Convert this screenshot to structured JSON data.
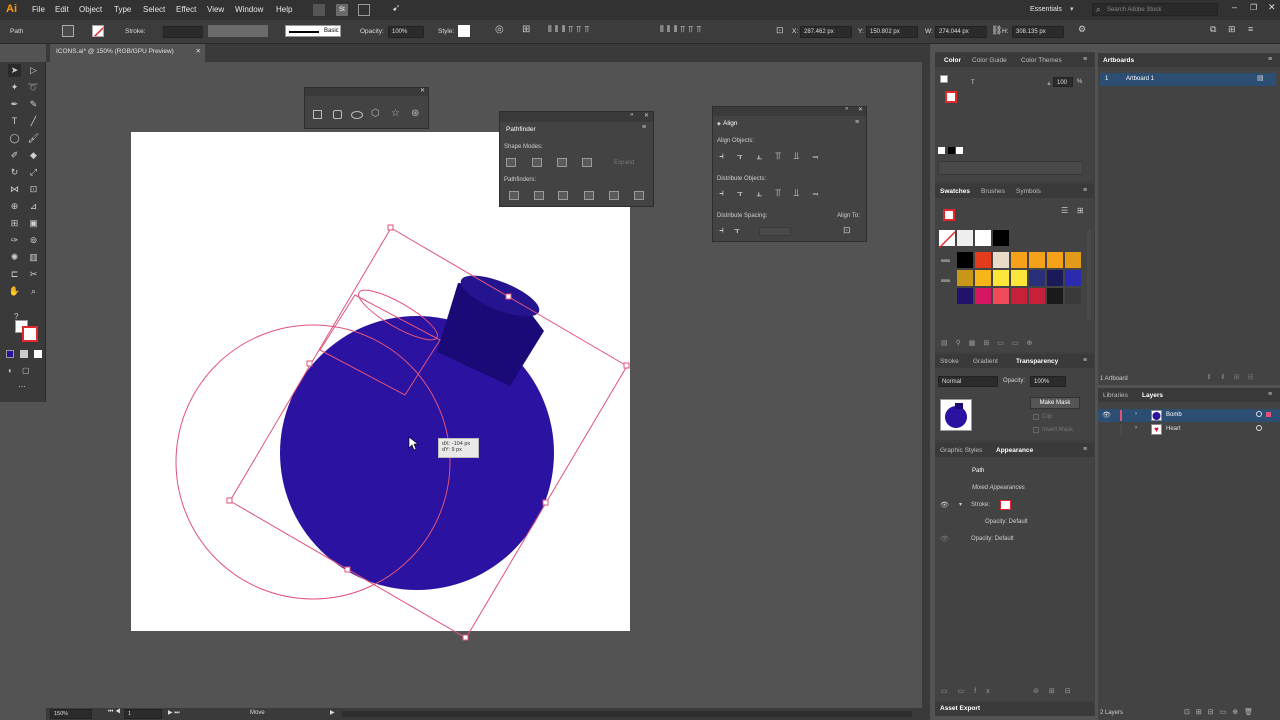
{
  "menubar": {
    "logo": "Ai",
    "menus": [
      "File",
      "Edit",
      "Object",
      "Type",
      "Select",
      "Effect",
      "View",
      "Window",
      "Help"
    ],
    "workspace": "Essentials",
    "search_placeholder": "Search Adobe Stock"
  },
  "controlbar": {
    "selection_label": "Path",
    "stroke_label": "Stroke:",
    "brush_label": "Basic",
    "opacity_label": "Opacity:",
    "opacity_value": "100%",
    "style_label": "Style:",
    "x_label": "X:",
    "x_value": "287.462 px",
    "y_label": "Y:",
    "y_value": "150.802 px",
    "w_label": "W:",
    "w_value": "274.044 px",
    "h_label": "H:",
    "h_value": "308.135 px"
  },
  "document": {
    "tab_title": "ICONS.ai* @ 150% (RGB/GPU Preview)",
    "tooltip_dx": "dX: -104 px",
    "tooltip_dy": "dY: 9 px"
  },
  "status": {
    "zoom": "150%",
    "artboard_num": "1",
    "tool_name": "Move"
  },
  "pathfinder": {
    "title": "Pathfinder",
    "shape_modes": "Shape Modes:",
    "expand": "Expand",
    "pathfinders": "Pathfinders:"
  },
  "align": {
    "title": "Align",
    "align_objects": "Align Objects:",
    "distribute_objects": "Distribute Objects:",
    "distribute_spacing": "Distribute Spacing:",
    "align_to": "Align To:"
  },
  "color_panel": {
    "tabs": [
      "Color",
      "Color Guide",
      "Color Themes"
    ],
    "t_value": "T",
    "value": "100",
    "percent": "%"
  },
  "swatches_panel": {
    "tabs": [
      "Swatches",
      "Brushes",
      "Symbols"
    ]
  },
  "transparency_panel": {
    "tabs": [
      "Stroke",
      "Gradient",
      "Transparency"
    ],
    "blend_mode": "Normal",
    "opacity_label": "Opacity:",
    "opacity_value": "100%",
    "make_mask": "Make Mask",
    "clip": "Clip",
    "invert_mask": "Invert Mask"
  },
  "appearance_panel": {
    "tabs": [
      "Graphic Styles",
      "Appearance"
    ],
    "path": "Path",
    "mixed": "Mixed Appearances",
    "stroke": "Stroke:",
    "opacity1": "Opacity: Default",
    "opacity2": "Opacity: Default"
  },
  "asset_export": {
    "title": "Asset Export"
  },
  "artboards_panel": {
    "title": "Artboards",
    "row_num": "1",
    "row_name": "Artboard 1",
    "count": "1 Artboard"
  },
  "layers_panel": {
    "tabs": [
      "Libraries",
      "Layers"
    ],
    "layers": [
      "Bomb",
      "Heart"
    ],
    "count": "2 Layers"
  },
  "colors": {
    "bomb_fill": "#2b12a0",
    "bomb_cap": "#1a0a78",
    "selection": "#e0527a",
    "ui_bg": "#535353"
  },
  "swatch_colors": [
    [
      "#000000",
      "#e53b1d",
      "#e8dcc8",
      "#f5a21a",
      "#f5a21a",
      "#f5a21a",
      "#e19b18"
    ],
    [
      "#c99718",
      "#f7b51a",
      "#fce63a",
      "#fce63a",
      "#2a2f7a",
      "#1a1a5a",
      "#2b2bb0"
    ],
    [
      "#24126a",
      "#d41663",
      "#f04a5a",
      "#c81f3a",
      "#c81f3a",
      "#1a1a1a",
      "#3a3a3a"
    ]
  ]
}
